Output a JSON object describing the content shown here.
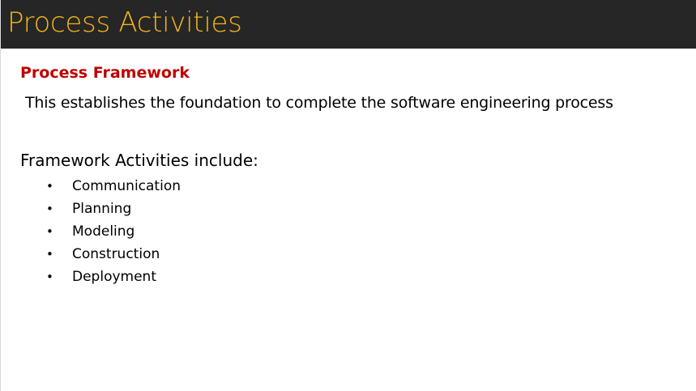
{
  "slide": {
    "title": "Process Activities",
    "section_heading": "Process Framework",
    "description": "This establishes the foundation to complete the software engineering process",
    "list_heading": "Framework Activities include:",
    "bullet_glyph": "•",
    "activities": [
      "Communication",
      "Planning",
      "Modeling",
      "Construction",
      "Deployment"
    ]
  },
  "colors": {
    "title_bar_background": "#262626",
    "title_text": "#f2b51c",
    "section_heading_text": "#c00000",
    "body_text": "#000000"
  }
}
